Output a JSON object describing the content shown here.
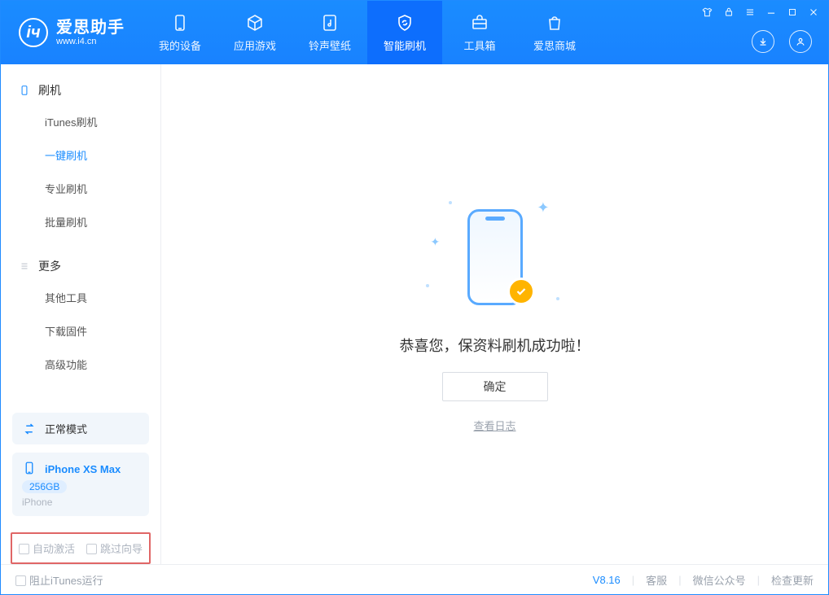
{
  "app": {
    "title": "爱思助手",
    "url": "www.i4.cn"
  },
  "tabs": {
    "device": "我的设备",
    "apps": "应用游戏",
    "ringtones": "铃声壁纸",
    "flash": "智能刷机",
    "toolbox": "工具箱",
    "store": "爱思商城"
  },
  "sidebar": {
    "section1": {
      "title": "刷机",
      "items": [
        "iTunes刷机",
        "一键刷机",
        "专业刷机",
        "批量刷机"
      ]
    },
    "section2": {
      "title": "更多",
      "items": [
        "其他工具",
        "下载固件",
        "高级功能"
      ]
    }
  },
  "device": {
    "mode": "正常模式",
    "name": "iPhone XS Max",
    "storage": "256GB",
    "type": "iPhone"
  },
  "options": {
    "auto_activate": "自动激活",
    "skip_guide": "跳过向导"
  },
  "main": {
    "message": "恭喜您，保资料刷机成功啦！",
    "ok": "确定",
    "view_log": "查看日志"
  },
  "footer": {
    "block_itunes": "阻止iTunes运行",
    "version": "V8.16",
    "support": "客服",
    "wechat": "微信公众号",
    "check_update": "检查更新"
  }
}
